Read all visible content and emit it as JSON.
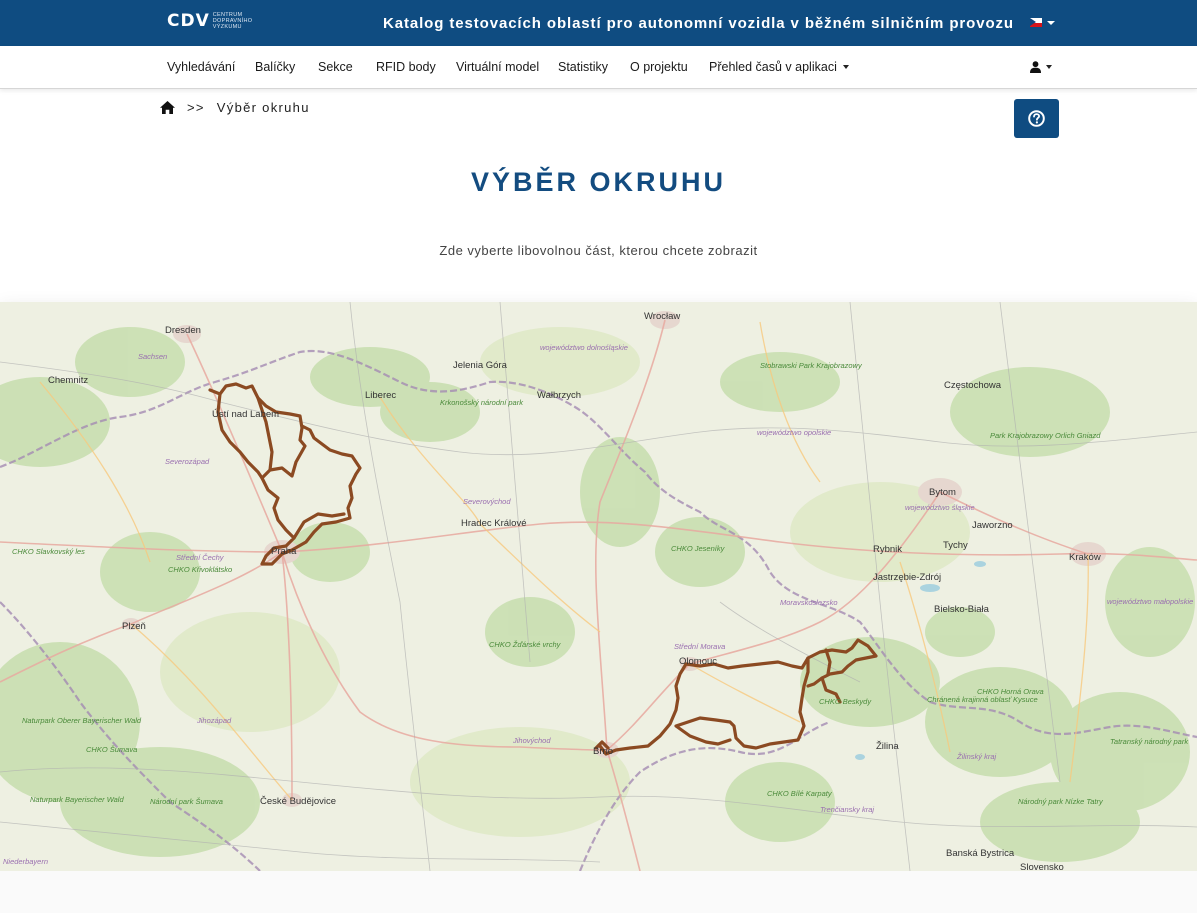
{
  "header": {
    "logo_mark": "CDV",
    "logo_lines": [
      "CENTRUM",
      "DOPRAVNÍHO",
      "VÝZKUMU"
    ],
    "title": "Katalog testovacích oblastí pro autonomní vozidla v běžném silničním provozu",
    "language": "cs"
  },
  "nav": {
    "items": [
      "Vyhledávání",
      "Balíčky",
      "Sekce",
      "RFID body",
      "Virtuální model",
      "Statistiky",
      "O projektu",
      "Přehled časů v aplikaci"
    ]
  },
  "breadcrumb": {
    "separator": ">>",
    "current": "Výběr okruhu"
  },
  "page": {
    "title": "VÝBĚR OKRUHU",
    "subtitle": "Zde vyberte libovolnou část, kterou chcete zobrazit"
  },
  "map": {
    "route_color": "#8b4a22",
    "labels": {
      "cities": [
        "Dresden",
        "Chemnitz",
        "Wrocław",
        "Jelenia Góra",
        "Liberec",
        "Wałbrzych",
        "Częstochowa",
        "Ústí nad Labem",
        "Hradec Králové",
        "Praha",
        "Bytom",
        "Jaworzno",
        "Tychy",
        "Rybnik",
        "Kraków",
        "Jastrzębie-Zdrój",
        "Bielsko-Biała",
        "Plzeň",
        "Olomouc",
        "Brno",
        "České Budějovice",
        "Žilina",
        "Banská Bystrica"
      ],
      "regions": [
        "Sachsen",
        "województwo dolnośląskie",
        "Stobrawski Park Krajobrazowy",
        "Krkonošský národní park",
        "województwo opolskie",
        "Park Krajobrazowy Orlich Gniazd",
        "Severozápad",
        "Severovýchod",
        "województwo śląskie",
        "CHKO Slavkovský les",
        "Střední Čechy",
        "CHKO Křivoklátsko",
        "CHKO Jeseníky",
        "Moravskoslezsko",
        "województwo małopolskie",
        "Střední Morava",
        "CHKO Žďárské vrchy",
        "Naturpark Oberer Bayerischer Wald",
        "CHKO Šumava",
        "Jihozápad",
        "Jihovýchod",
        "CHKO Beskydy",
        "Chránená krajinná oblasť Kysuce",
        "CHKO Horná Orava",
        "Tatranský národný park",
        "Naturpark Bayerischer Wald",
        "Národní park Šumava",
        "CHKO Bílé Karpaty",
        "Trenčiansky kraj",
        "Žilinský kraj",
        "Národný park Nízke Tatry",
        "Niederbayern",
        "Slovensko"
      ]
    }
  }
}
